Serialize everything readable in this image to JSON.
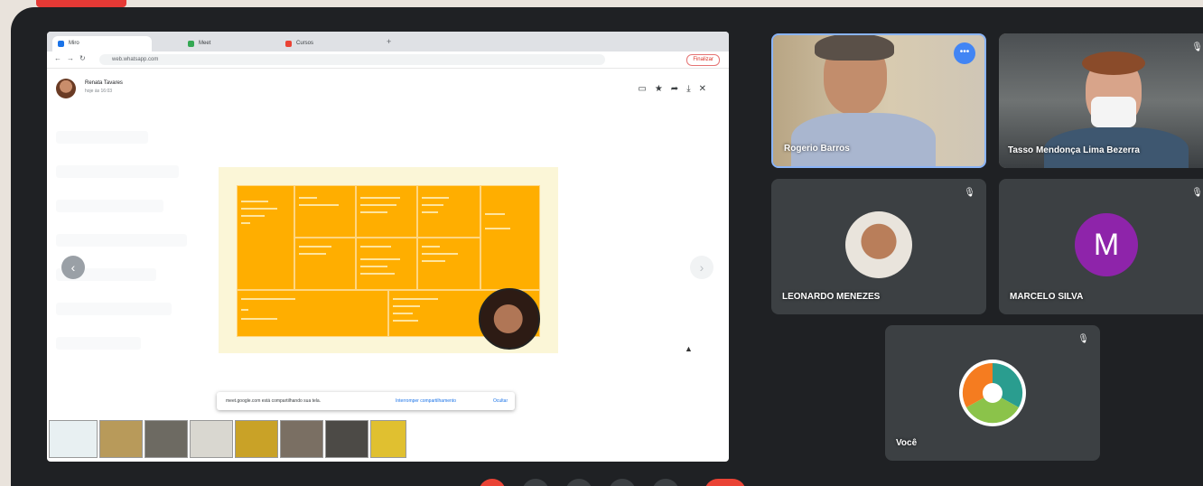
{
  "browser": {
    "tabs": [
      {
        "label": "Miro",
        "favicon": "#1a73e8"
      },
      {
        "label": "Meet",
        "favicon": "#34a853"
      },
      {
        "label": "Cursos",
        "favicon": "#ea4335"
      }
    ],
    "url": "web.whatsapp.com",
    "finish_label": "Finalizar"
  },
  "viewer": {
    "sender_name": "Renata Tavares",
    "sender_time": "hoje às 16:03",
    "tool_icons": [
      "comment-icon",
      "star-icon",
      "forward-icon",
      "download-icon",
      "close-icon"
    ]
  },
  "toast": {
    "message": "meet.google.com está compartilhando sua tela.",
    "stop_label": "Interromper compartilhamento",
    "hide_label": "Ocultar"
  },
  "participants": [
    {
      "name": "Rogerio Barros",
      "kind": "video"
    },
    {
      "name": "Tasso Mendonça Lima Bezerra",
      "kind": "video"
    },
    {
      "name": "LEONARDO MENEZES",
      "kind": "photo"
    },
    {
      "name": "MARCELO SILVA",
      "kind": "initial",
      "initial": "M",
      "color": "#8e24aa"
    },
    {
      "name": "Você",
      "kind": "logo"
    }
  ],
  "colors": {
    "accent_blue": "#4285f4",
    "end_call_red": "#ea4335",
    "slide_orange": "#ffae00",
    "slide_bg": "#fbf6d7"
  }
}
